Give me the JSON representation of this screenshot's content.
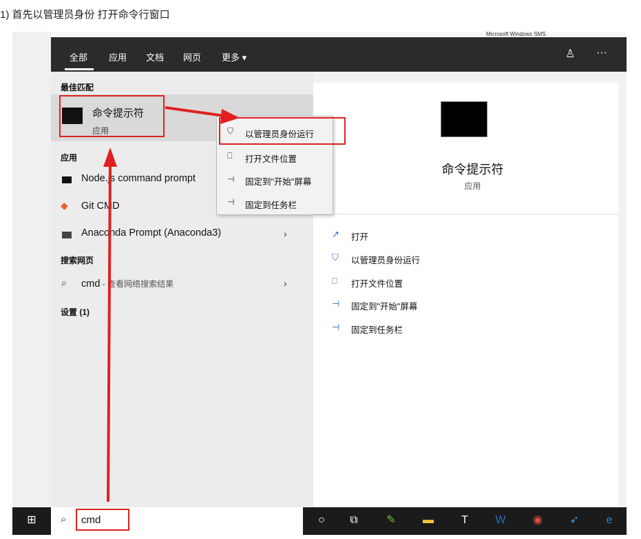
{
  "caption": "1) 首先以管理员身份 打开命令行窗口",
  "desktop_text": "Microsoft Windows SMS",
  "tabs": [
    "全部",
    "应用",
    "文档",
    "网页",
    "更多 ▾"
  ],
  "sections": {
    "best": "最佳匹配",
    "apps": "应用",
    "web": "搜索网页",
    "settings": "设置 (1)"
  },
  "best_match": {
    "title": "命令提示符",
    "subtitle": "应用"
  },
  "apps": [
    "Node.js command prompt",
    "Git CMD",
    "Anaconda Prompt (Anaconda3)"
  ],
  "web_item": {
    "query": "cmd",
    "hint": " - 查看网络搜索结果"
  },
  "context_menu": [
    "以管理员身份运行",
    "打开文件位置",
    "固定到\"开始\"屏幕",
    "固定到任务栏"
  ],
  "right_panel": {
    "title": "命令提示符",
    "subtitle": "应用",
    "actions": [
      "打开",
      "以管理员身份运行",
      "打开文件位置",
      "固定到\"开始\"屏幕",
      "固定到任务栏"
    ]
  },
  "search_value": "cmd",
  "colors": {
    "highlight": "#e02020",
    "topbar": "#2b2b2b",
    "accent": "#2b6cc4"
  }
}
